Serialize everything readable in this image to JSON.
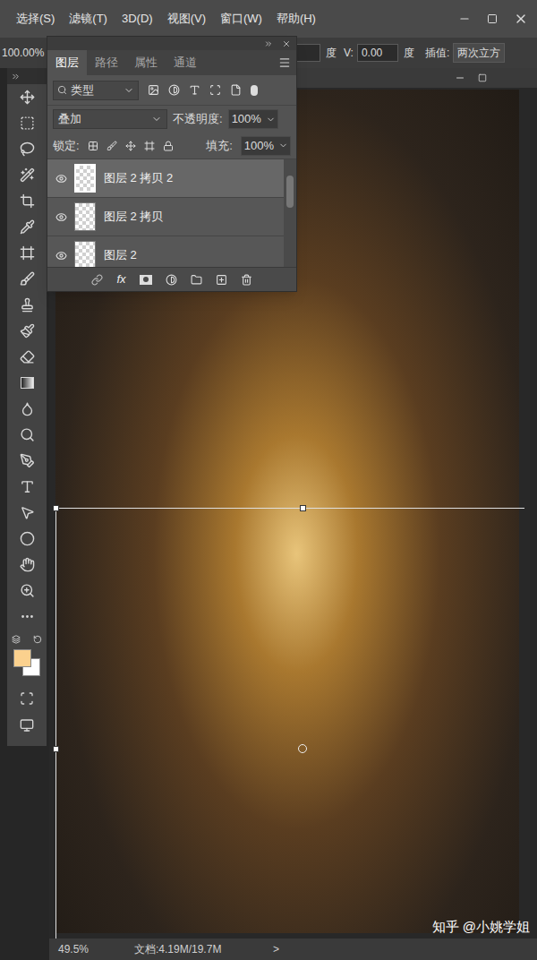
{
  "menu": [
    {
      "label": "选择(S)"
    },
    {
      "label": "滤镜(T)"
    },
    {
      "label": "3D(D)"
    },
    {
      "label": "视图(V)"
    },
    {
      "label": "窗口(W)"
    },
    {
      "label": "帮助(H)"
    }
  ],
  "options_bar": {
    "zoom": "100.00%",
    "angle_unit": "度",
    "v_label": "V:",
    "v_value": "0.00",
    "v_unit": "度",
    "interpolation_label": "插值:",
    "interpolation_value": "两次立方"
  },
  "layers_panel": {
    "tabs": [
      {
        "label": "图层",
        "selected": true
      },
      {
        "label": "路径",
        "selected": false
      },
      {
        "label": "属性",
        "selected": false
      },
      {
        "label": "通道",
        "selected": false
      }
    ],
    "filter": {
      "label": "类型"
    },
    "blend_mode": "叠加",
    "opacity_label": "不透明度:",
    "opacity": "100%",
    "lock_label": "锁定:",
    "fill_label": "填充:",
    "fill": "100%",
    "layers": [
      {
        "name": "图层 2 拷贝 2",
        "visible": true,
        "selected": true
      },
      {
        "name": "图层 2 拷贝",
        "visible": true,
        "selected": false
      },
      {
        "name": "图层 2",
        "visible": true,
        "selected": false
      }
    ],
    "effects_button": "fx"
  },
  "swatches": {
    "foreground": "#fbd18e",
    "background": "#ffffff"
  },
  "status_bar": {
    "zoom": "49.5%",
    "document": "文档:4.19M/19.7M",
    "arrow": ">"
  },
  "watermark": "知乎 @小姚学姐"
}
